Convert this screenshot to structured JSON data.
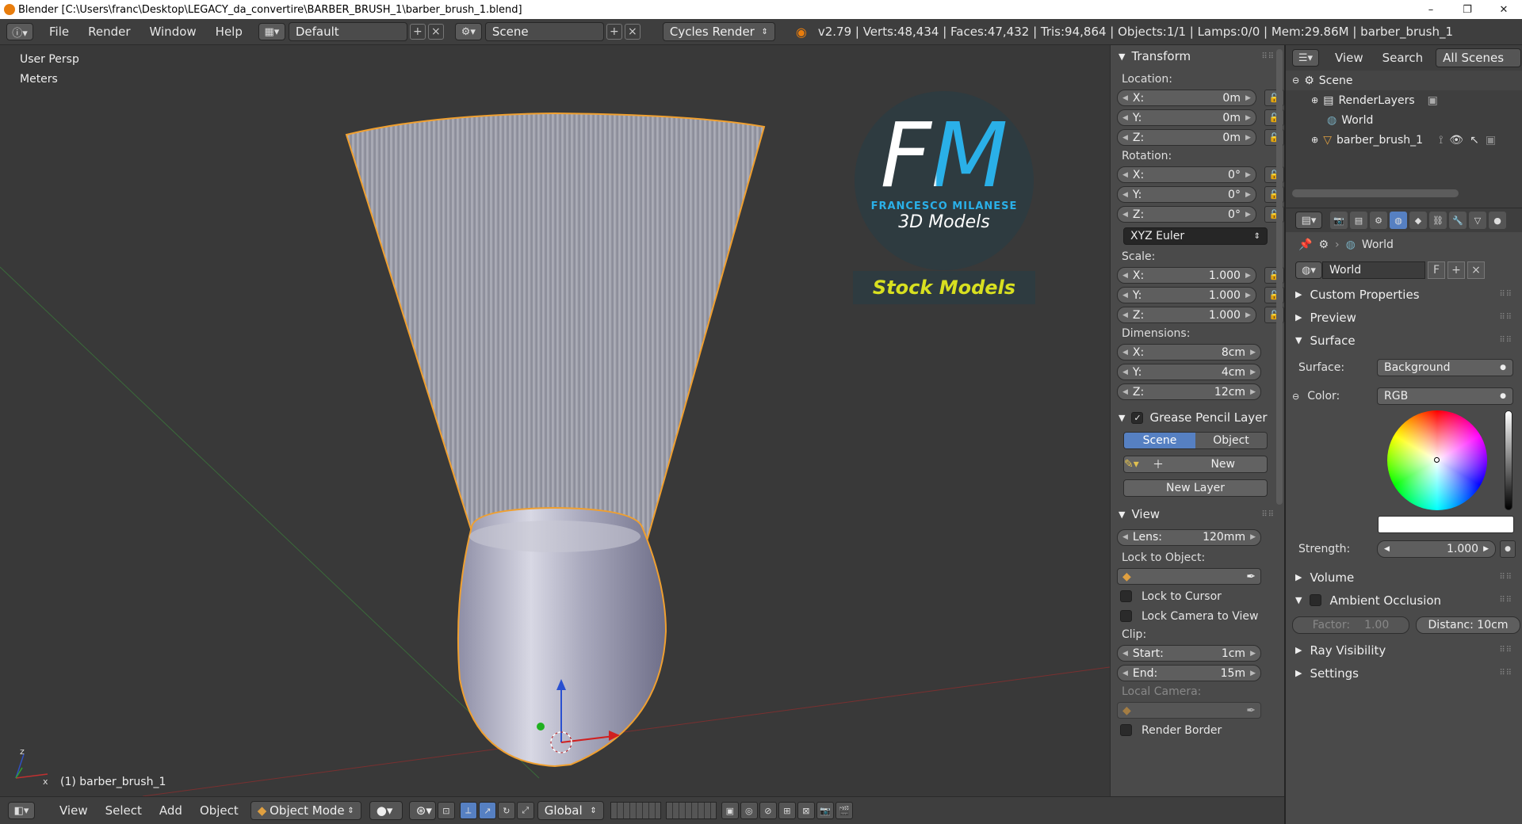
{
  "window": {
    "title": "Blender [C:\\Users\\franc\\Desktop\\LEGACY_da_convertire\\BARBER_BRUSH_1\\barber_brush_1.blend]",
    "minimize": "–",
    "maximize": "❐",
    "close": "✕"
  },
  "info_header": {
    "menus": [
      "File",
      "Render",
      "Window",
      "Help"
    ],
    "layout": "Default",
    "scene": "Scene",
    "engine": "Cycles Render",
    "stats": "v2.79 | Verts:48,434 | Faces:47,432 | Tris:94,864 | Objects:1/1 | Lamps:0/0 | Mem:29.86M | barber_brush_1"
  },
  "viewport": {
    "view_name": "User Persp",
    "units": "Meters",
    "object_label": "(1) barber_brush_1",
    "logo": {
      "initials": "FM",
      "name": "FRANCESCO MILANESE",
      "subtitle": "3D Models",
      "banner": "Stock Models"
    }
  },
  "n_panel": {
    "transform": {
      "title": "Transform",
      "location_label": "Location:",
      "location": [
        {
          "axis": "X:",
          "value": "0m"
        },
        {
          "axis": "Y:",
          "value": "0m"
        },
        {
          "axis": "Z:",
          "value": "0m"
        }
      ],
      "rotation_label": "Rotation:",
      "rotation": [
        {
          "axis": "X:",
          "value": "0°"
        },
        {
          "axis": "Y:",
          "value": "0°"
        },
        {
          "axis": "Z:",
          "value": "0°"
        }
      ],
      "rotation_mode": "XYZ Euler",
      "scale_label": "Scale:",
      "scale": [
        {
          "axis": "X:",
          "value": "1.000"
        },
        {
          "axis": "Y:",
          "value": "1.000"
        },
        {
          "axis": "Z:",
          "value": "1.000"
        }
      ],
      "dimensions_label": "Dimensions:",
      "dimensions": [
        {
          "axis": "X:",
          "value": "8cm"
        },
        {
          "axis": "Y:",
          "value": "4cm"
        },
        {
          "axis": "Z:",
          "value": "12cm"
        }
      ]
    },
    "grease_pencil": {
      "title": "Grease Pencil Layer",
      "scene_tab": "Scene",
      "object_tab": "Object",
      "new_label": "New",
      "new_layer_label": "New Layer"
    },
    "view": {
      "title": "View",
      "lens_label": "Lens:",
      "lens_value": "120mm",
      "lock_object_label": "Lock to Object:",
      "lock_cursor": "Lock to Cursor",
      "lock_camera": "Lock Camera to View",
      "clip_label": "Clip:",
      "clip_start_label": "Start:",
      "clip_start": "1cm",
      "clip_end_label": "End:",
      "clip_end": "15m",
      "local_camera": "Local Camera:",
      "render_border": "Render Border"
    }
  },
  "outliner": {
    "view": "View",
    "search": "Search",
    "filter": "All Scenes",
    "items": [
      "Scene",
      "RenderLayers",
      "World",
      "barber_brush_1"
    ]
  },
  "properties": {
    "context": "World",
    "world_name": "World",
    "fake_user": "F",
    "sections": {
      "custom": "Custom Properties",
      "preview": "Preview",
      "surface": "Surface",
      "volume": "Volume",
      "ao": "Ambient Occlusion",
      "ray": "Ray Visibility",
      "settings": "Settings"
    },
    "surface_label": "Surface:",
    "surface_value": "Background",
    "color_label": "Color:",
    "color_value": "RGB",
    "strength_label": "Strength:",
    "strength_value": "1.000",
    "factor_label": "Factor:",
    "factor_value": "1.00",
    "distance": "Distanc: 10cm"
  },
  "bottom_bar": {
    "menus": [
      "View",
      "Select",
      "Add",
      "Object"
    ],
    "mode": "Object Mode",
    "orientation": "Global"
  },
  "colors": {
    "selection_outline": "#f0a030",
    "background": "#393939",
    "panel": "#4a4a4a",
    "active_tab": "#5680c2",
    "logo_text": "#d8e020"
  }
}
